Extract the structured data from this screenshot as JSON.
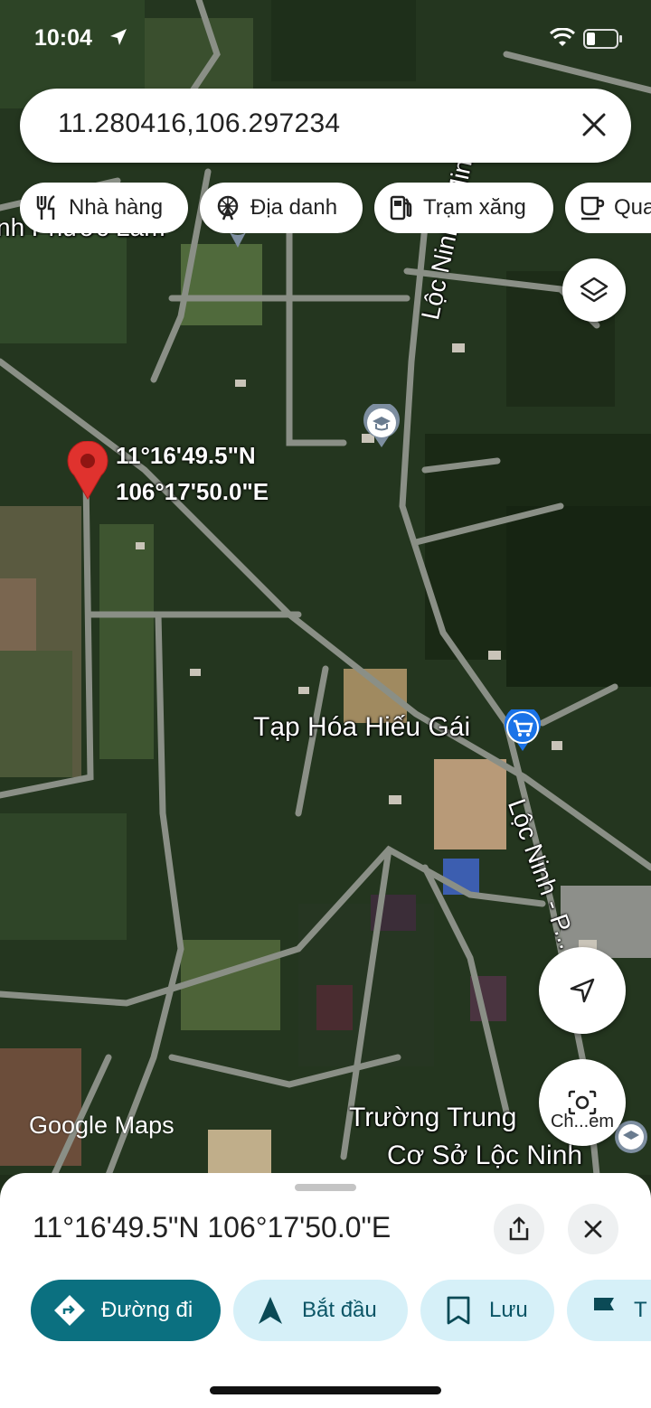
{
  "status_bar": {
    "time": "10:04"
  },
  "search": {
    "query": "11.280416,106.297234"
  },
  "chips": [
    {
      "label": "Nhà hàng",
      "icon": "fork-knife-icon"
    },
    {
      "label": "Địa danh",
      "icon": "ferris-wheel-icon"
    },
    {
      "label": "Trạm xăng",
      "icon": "gas-station-icon"
    },
    {
      "label": "Qua",
      "icon": "coffee-cup-icon"
    }
  ],
  "map": {
    "labels": {
      "top_partial": "nh Phước Lam",
      "road_north": "Lộc Ninh - Minh",
      "store": "Tạp Hóa Hiếu Gái",
      "road_south": "Lộc Ninh - P... Minh",
      "school_line1": "Trường Trung",
      "school_line2": "Cơ Sở Lộc Ninh"
    },
    "pin": {
      "lat": "11°16'49.5\"N",
      "lng": "106°17'50.0\"E"
    },
    "attribution": "Google Maps",
    "lens_label": "Ch...em"
  },
  "sheet": {
    "coords": "11°16'49.5\"N 106°17'50.0\"E",
    "actions": [
      {
        "label": "Đường đi",
        "icon": "directions-icon"
      },
      {
        "label": "Bắt đầu",
        "icon": "navigation-arrow-icon"
      },
      {
        "label": "Lưu",
        "icon": "bookmark-icon"
      },
      {
        "label": "T",
        "icon": "flag-icon"
      }
    ]
  },
  "colors": {
    "primary": "#0b7080",
    "chip_bg": "#d6f0f8",
    "pin": "#e0322e"
  }
}
